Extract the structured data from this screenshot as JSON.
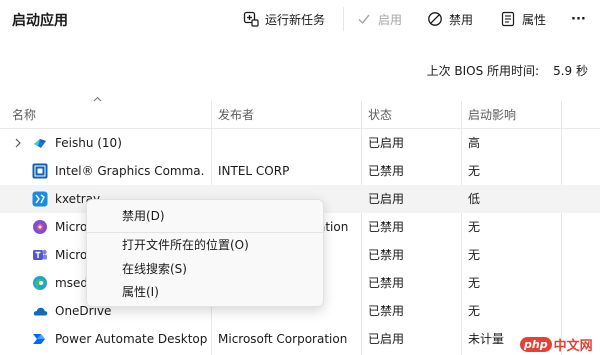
{
  "header": {
    "title": "启动应用",
    "run_new_task": "运行新任务",
    "enable": "启用",
    "disable": "禁用",
    "properties": "属性",
    "more": "···"
  },
  "bios": {
    "label": "上次 BIOS 所用时间:",
    "value": "5.9 秒"
  },
  "columns": [
    "名称",
    "发布者",
    "状态",
    "启动影响"
  ],
  "rows": [
    {
      "name": "Feishu (10)",
      "publisher": "",
      "status": "已启用",
      "impact": "高",
      "icon": "feishu-icon"
    },
    {
      "name": "Intel® Graphics Comma...",
      "publisher": "INTEL CORP",
      "status": "已禁用",
      "impact": "无",
      "icon": "intel-graphics-icon"
    },
    {
      "name": "kxetray",
      "publisher": "",
      "status": "已启用",
      "impact": "低",
      "icon": "kxetray-icon"
    },
    {
      "name": "Micro",
      "publisher": "ation",
      "status": "已禁用",
      "impact": "无",
      "icon": "microsoft-app-icon"
    },
    {
      "name": "Micro",
      "publisher": "",
      "status": "已禁用",
      "impact": "无",
      "icon": "microsoft-teams-icon"
    },
    {
      "name": "msed",
      "publisher": "",
      "status": "已禁用",
      "impact": "无",
      "icon": "edge-icon"
    },
    {
      "name": "OneDrive",
      "publisher": "",
      "status": "已禁用",
      "impact": "无",
      "icon": "onedrive-icon"
    },
    {
      "name": "Power Automate Desktop",
      "publisher": "Microsoft Corporation",
      "status": "已启用",
      "impact": "未计量",
      "icon": "power-automate-icon"
    }
  ],
  "context_menu": {
    "items": [
      "禁用(D)",
      "打开文件所在的位置(O)",
      "在线搜索(S)",
      "属性(I)"
    ]
  },
  "watermark": {
    "php": "php",
    "cn": "中文网"
  },
  "colors": {
    "accent": "#0067c0",
    "hover_row": "#f3f3f3",
    "watermark": "#e34234"
  }
}
